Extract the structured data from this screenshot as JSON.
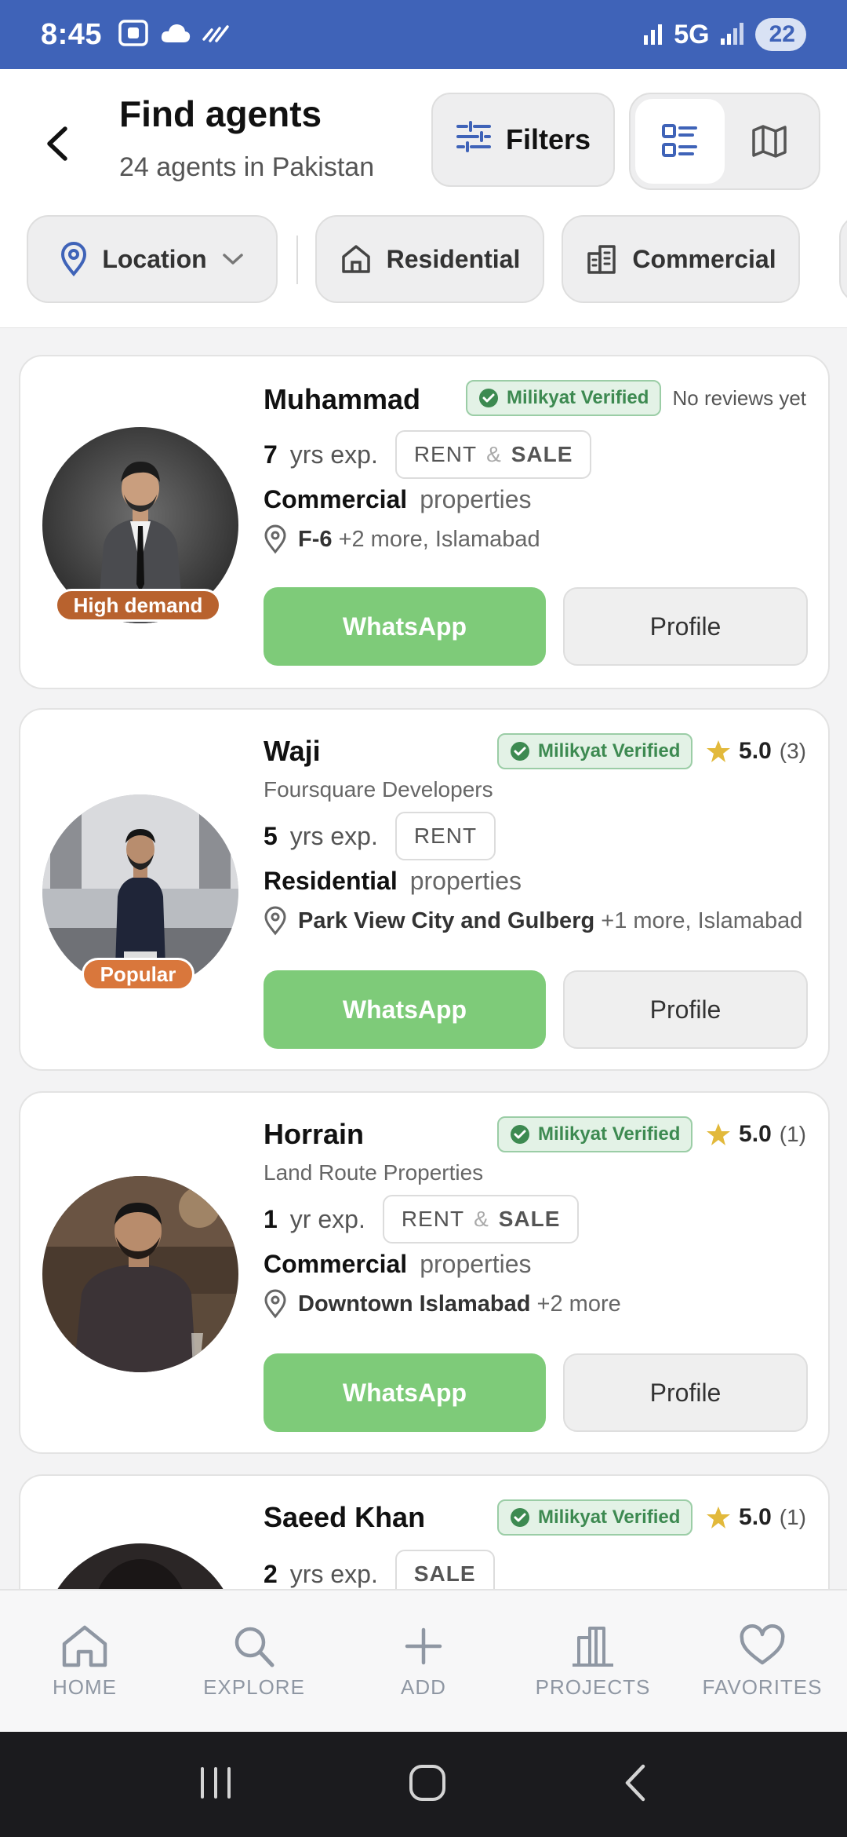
{
  "status_bar": {
    "time": "8:45",
    "network": "5G",
    "battery": "22"
  },
  "header": {
    "title": "Find agents",
    "subtitle": "24 agents in Pakistan",
    "filters_label": "Filters"
  },
  "chips": [
    {
      "label": "Location",
      "icon": "location-pin-icon"
    },
    {
      "label": "Residential",
      "icon": "home-icon"
    },
    {
      "label": "Commercial",
      "icon": "building-icon"
    }
  ],
  "agents": [
    {
      "name": "Muhammad",
      "verified": "Milikyat Verified",
      "reviews_text": "No reviews yet",
      "badge": "High demand",
      "exp_num": "7",
      "exp_unit": "yrs exp.",
      "deal_a": "RENT",
      "deal_amp": "&",
      "deal_b": "SALE",
      "property_type": "Commercial",
      "property_suffix": "properties",
      "location_main": "F-6",
      "location_more": "+2 more, Islamabad",
      "whatsapp": "WhatsApp",
      "profile": "Profile"
    },
    {
      "name": "Waji",
      "verified": "Milikyat Verified",
      "rating": "5.0",
      "rating_count": "(3)",
      "badge": "Popular",
      "company": "Foursquare Developers",
      "exp_num": "5",
      "exp_unit": "yrs exp.",
      "deal_a": "RENT",
      "property_type": "Residential",
      "property_suffix": "properties",
      "location_main": "Park View City and Gulberg",
      "location_more": "+1 more, Islamabad",
      "whatsapp": "WhatsApp",
      "profile": "Profile"
    },
    {
      "name": "Horrain",
      "verified": "Milikyat Verified",
      "rating": "5.0",
      "rating_count": "(1)",
      "company": "Land Route Properties",
      "exp_num": "1",
      "exp_unit": "yr exp.",
      "deal_a": "RENT",
      "deal_amp": "&",
      "deal_b": "SALE",
      "property_type": "Commercial",
      "property_suffix": "properties",
      "location_main": "Downtown Islamabad",
      "location_more": "+2 more",
      "whatsapp": "WhatsApp",
      "profile": "Profile"
    },
    {
      "name": "Saeed Khan",
      "verified": "Milikyat Verified",
      "rating": "5.0",
      "rating_count": "(1)",
      "exp_num": "2",
      "exp_unit": "yrs exp.",
      "deal_b": "SALE"
    }
  ],
  "bottom_nav": [
    {
      "label": "HOME",
      "icon": "home-icon"
    },
    {
      "label": "EXPLORE",
      "icon": "search-icon"
    },
    {
      "label": "ADD",
      "icon": "plus-icon"
    },
    {
      "label": "PROJECTS",
      "icon": "projects-icon"
    },
    {
      "label": "FAVORITES",
      "icon": "heart-icon"
    }
  ],
  "colors": {
    "status_bar": "#3f63b8",
    "accent_blue": "#3f63b8",
    "whatsapp_green": "#7ecb79",
    "verified_green": "#3d8a51",
    "high_demand_badge": "#b8622e",
    "popular_badge": "#d9773c",
    "star": "#e2b93b"
  }
}
